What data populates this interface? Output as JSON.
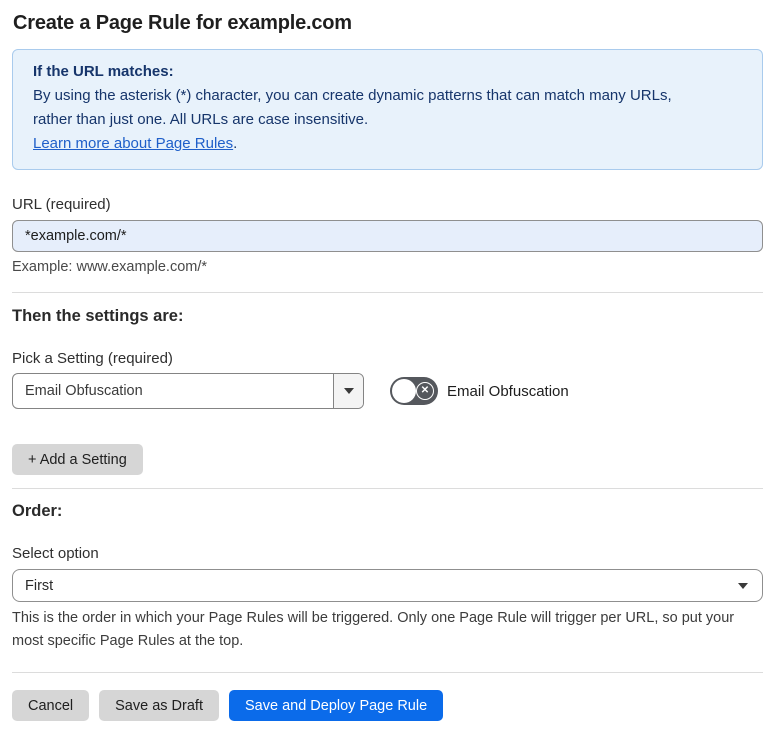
{
  "page": {
    "title": "Create a Page Rule for example.com"
  },
  "info_box": {
    "heading": "If the URL matches:",
    "body_lines": [
      "By using the asterisk (*) character, you can create dynamic patterns that can match many URLs,",
      "rather than just one. All URLs are case insensitive."
    ],
    "link_label": "Learn more about Page Rules",
    "link_suffix": "."
  },
  "url_field": {
    "label": "URL (required)",
    "value": "*example.com/*",
    "example": "Example: www.example.com/*"
  },
  "settings": {
    "heading": "Then the settings are:",
    "picker_label": "Pick a Setting (required)",
    "picker_value": "Email Obfuscation",
    "toggle_label": "Email Obfuscation",
    "toggle_state": "off",
    "toggle_icon": "✕",
    "add_button_label": "+ Add a Setting"
  },
  "order": {
    "heading": "Order:",
    "select_label": "Select option",
    "select_value": "First",
    "help": "This is the order in which your Page Rules will be triggered. Only one Page Rule will trigger per URL, so put your most specific Page Rules at the top."
  },
  "footer": {
    "cancel_label": "Cancel",
    "save_draft_label": "Save as Draft",
    "save_deploy_label": "Save and Deploy Page Rule"
  },
  "colors": {
    "primary_button": "#0b6bea",
    "gray_button": "#d6d6d6",
    "info_background": "#e8f2fb",
    "info_border": "#a9cbed",
    "info_text": "#16356b",
    "link": "#1f5fc9",
    "url_input_background": "#e6eefb",
    "toggle_off_background": "#55585d"
  }
}
